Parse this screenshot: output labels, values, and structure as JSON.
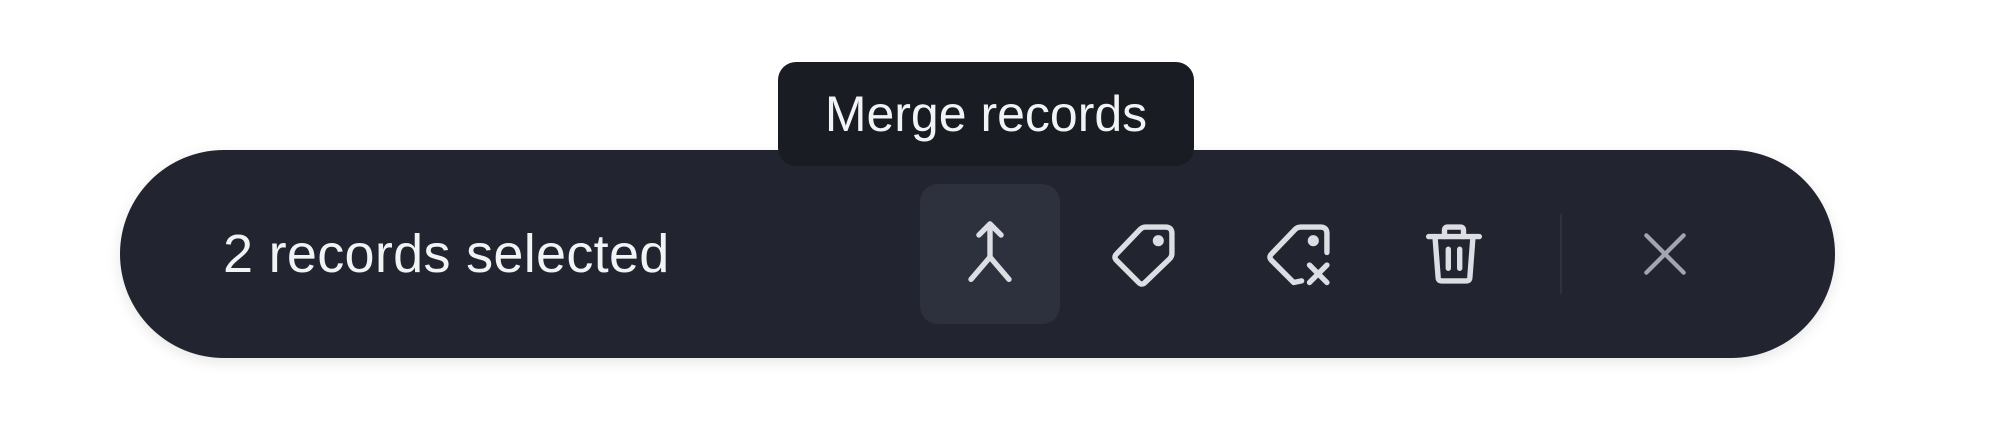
{
  "selection_bar": {
    "count_label": "2 records selected",
    "actions": [
      {
        "id": "merge",
        "icon": "merge-icon",
        "active": true
      },
      {
        "id": "add-tag",
        "icon": "tag-icon",
        "active": false
      },
      {
        "id": "remove-tag",
        "icon": "tag-remove-icon",
        "active": false
      },
      {
        "id": "delete",
        "icon": "trash-icon",
        "active": false
      }
    ],
    "close_icon": "close-icon"
  },
  "tooltip": {
    "text": "Merge records"
  },
  "colors": {
    "bar_background": "#222530",
    "active_button_background": "#2d313d",
    "tooltip_background": "#1a1c24",
    "text": "#f2f3f5",
    "icon": "#dcdee4",
    "close_icon": "#a3a6b0"
  }
}
